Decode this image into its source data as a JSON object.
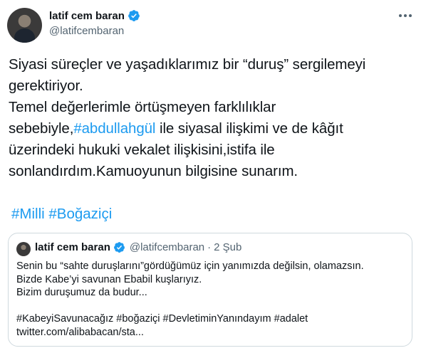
{
  "author": {
    "display_name": "latif cem baran",
    "handle": "@latifcembaran",
    "verified": true
  },
  "tweet": {
    "lines": [
      "Siyasi süreçler ve yaşadıklarımız bir “duruş” sergilemeyi",
      "gerektiriyor.",
      "Temel değerlerimle örtüşmeyen farklılıklar"
    ],
    "line4_prefix": "sebebiyle,",
    "line4_hashtag": "#abdullahgül",
    "line4_suffix": " ile siyasal ilişkimi ve de kâğıt",
    "line5": "üzerindeki hukuki vekalet ilişkisini,istifa ile",
    "line6": "sonlandırdım.Kamuoyunun bilgisine sunarım.",
    "hashtags": [
      "#Milli",
      "#Boğaziçi"
    ]
  },
  "quoted_tweet": {
    "display_name": "latif cem baran",
    "handle": "@latifcembaran",
    "separator": "·",
    "date": "2 Şub",
    "lines": [
      "Senin bu “sahte duruşlarını”gördüğümüz için yanımızda değilsin, olamazsın.",
      "Bizde Kabe’yi savunan Ebabil kuşlarıyız.",
      "Bizim duruşumuz da budur...",
      "",
      "#KabeyiSavunacağız #boğaziçi #DevletiminYanındayım #adalet",
      "twitter.com/alibabacan/sta..."
    ]
  },
  "icons": {
    "verified": "verified-badge-icon",
    "more": "more-options-icon"
  },
  "colors": {
    "link": "#1d9bf0",
    "secondary_text": "#536471",
    "border": "#cfd9de",
    "verified": "#1d9bf0"
  }
}
